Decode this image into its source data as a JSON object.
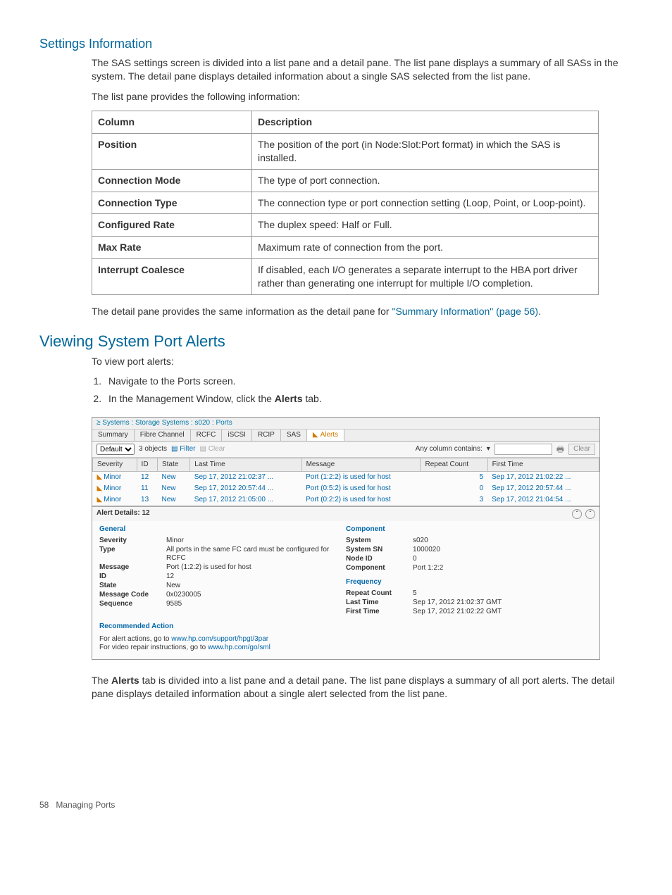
{
  "headings": {
    "settings": "Settings Information",
    "viewing": "Viewing System Port Alerts"
  },
  "text": {
    "settings_p1": "The SAS settings screen is divided into a list pane and a detail pane. The list pane displays a summary of all SASs in the system. The detail pane displays detailed information about a single SAS selected from the list pane.",
    "settings_p2": "The list pane provides the following information:",
    "detail_pane_a": "The detail pane provides the same information as the detail pane for ",
    "detail_pane_link": "\"Summary Information\" (page 56)",
    "detail_pane_b": ".",
    "view_alerts_intro": "To view port alerts:",
    "step1": "Navigate to the Ports screen.",
    "step2_a": "In the Management Window, click the ",
    "step2_b": "Alerts",
    "step2_c": " tab.",
    "after_shot_a": "The ",
    "after_shot_b": "Alerts",
    "after_shot_c": " tab is divided into a list pane and a detail pane. The list pane displays a summary of all port alerts. The detail pane displays detailed information about a single alert selected from the list pane."
  },
  "table": {
    "headers": {
      "col": "Column",
      "desc": "Description"
    },
    "rows": [
      {
        "c": "Position",
        "d": "The position of the port (in Node:Slot:Port format) in which the SAS is installed."
      },
      {
        "c": "Connection Mode",
        "d": "The type of port connection."
      },
      {
        "c": "Connection Type",
        "d": "The connection type or port connection setting (Loop, Point, or Loop-point)."
      },
      {
        "c": "Configured Rate",
        "d": "The duplex speed: Half or Full."
      },
      {
        "c": "Max Rate",
        "d": "Maximum rate of connection from the port."
      },
      {
        "c": "Interrupt Coalesce",
        "d": "If disabled, each I/O generates a separate interrupt to the HBA port driver rather than generating one interrupt for multiple I/O completion."
      }
    ]
  },
  "shot": {
    "breadcrumb": "Systems : Storage Systems : s020 : Ports",
    "tabs": [
      "Summary",
      "Fibre Channel",
      "RCFC",
      "iSCSI",
      "RCIP",
      "SAS",
      "Alerts"
    ],
    "toolbar": {
      "default": "Default",
      "objects": "3 objects",
      "filter": "Filter",
      "clear1": "Clear",
      "any": "Any column contains:",
      "clear2": "Clear"
    },
    "cols": [
      "Severity",
      "ID",
      "State",
      "Last Time",
      "Message",
      "Repeat Count",
      "First Time"
    ],
    "rows": [
      {
        "sev": "Minor",
        "id": "12",
        "state": "New",
        "last": "Sep 17, 2012 21:02:37 ...",
        "msg": "Port (1:2:2) is used for host",
        "rc": "5",
        "first": "Sep 17, 2012 21:02:22 ..."
      },
      {
        "sev": "Minor",
        "id": "11",
        "state": "New",
        "last": "Sep 17, 2012 20:57:44 ...",
        "msg": "Port (0:5:2) is used for host",
        "rc": "0",
        "first": "Sep 17, 2012 20:57:44 ..."
      },
      {
        "sev": "Minor",
        "id": "13",
        "state": "New",
        "last": "Sep 17, 2012 21:05:00 ...",
        "msg": "Port (0:2:2) is used for host",
        "rc": "3",
        "first": "Sep 17, 2012 21:04:54 ..."
      }
    ],
    "details": {
      "header": "Alert Details: 12",
      "general": {
        "title": "General",
        "severity_k": "Severity",
        "severity_v": "Minor",
        "type_k": "Type",
        "type_v": "All ports in the same FC card must be configured for RCFC",
        "message_k": "Message",
        "message_v": "Port (1:2:2) is used for host",
        "id_k": "ID",
        "id_v": "12",
        "state_k": "State",
        "state_v": "New",
        "code_k": "Message Code",
        "code_v": "0x0230005",
        "seq_k": "Sequence",
        "seq_v": "9585"
      },
      "component": {
        "title": "Component",
        "system_k": "System",
        "system_v": "s020",
        "sn_k": "System SN",
        "sn_v": "1000020",
        "node_k": "Node ID",
        "node_v": "0",
        "comp_k": "Component",
        "comp_v": "Port 1:2:2"
      },
      "frequency": {
        "title": "Frequency",
        "rc_k": "Repeat Count",
        "rc_v": "5",
        "last_k": "Last Time",
        "last_v": "Sep 17, 2012 21:02:37 GMT",
        "first_k": "First Time",
        "first_v": "Sep 17, 2012 21:02:22 GMT"
      },
      "rec": {
        "title": "Recommended Action",
        "line1a": "For alert actions, go to ",
        "line1b": "www.hp.com/support/hpgt/3par",
        "line2a": "For video repair instructions, go to ",
        "line2b": "www.hp.com/go/sml"
      }
    }
  },
  "footer": {
    "page": "58",
    "section": "Managing Ports"
  }
}
